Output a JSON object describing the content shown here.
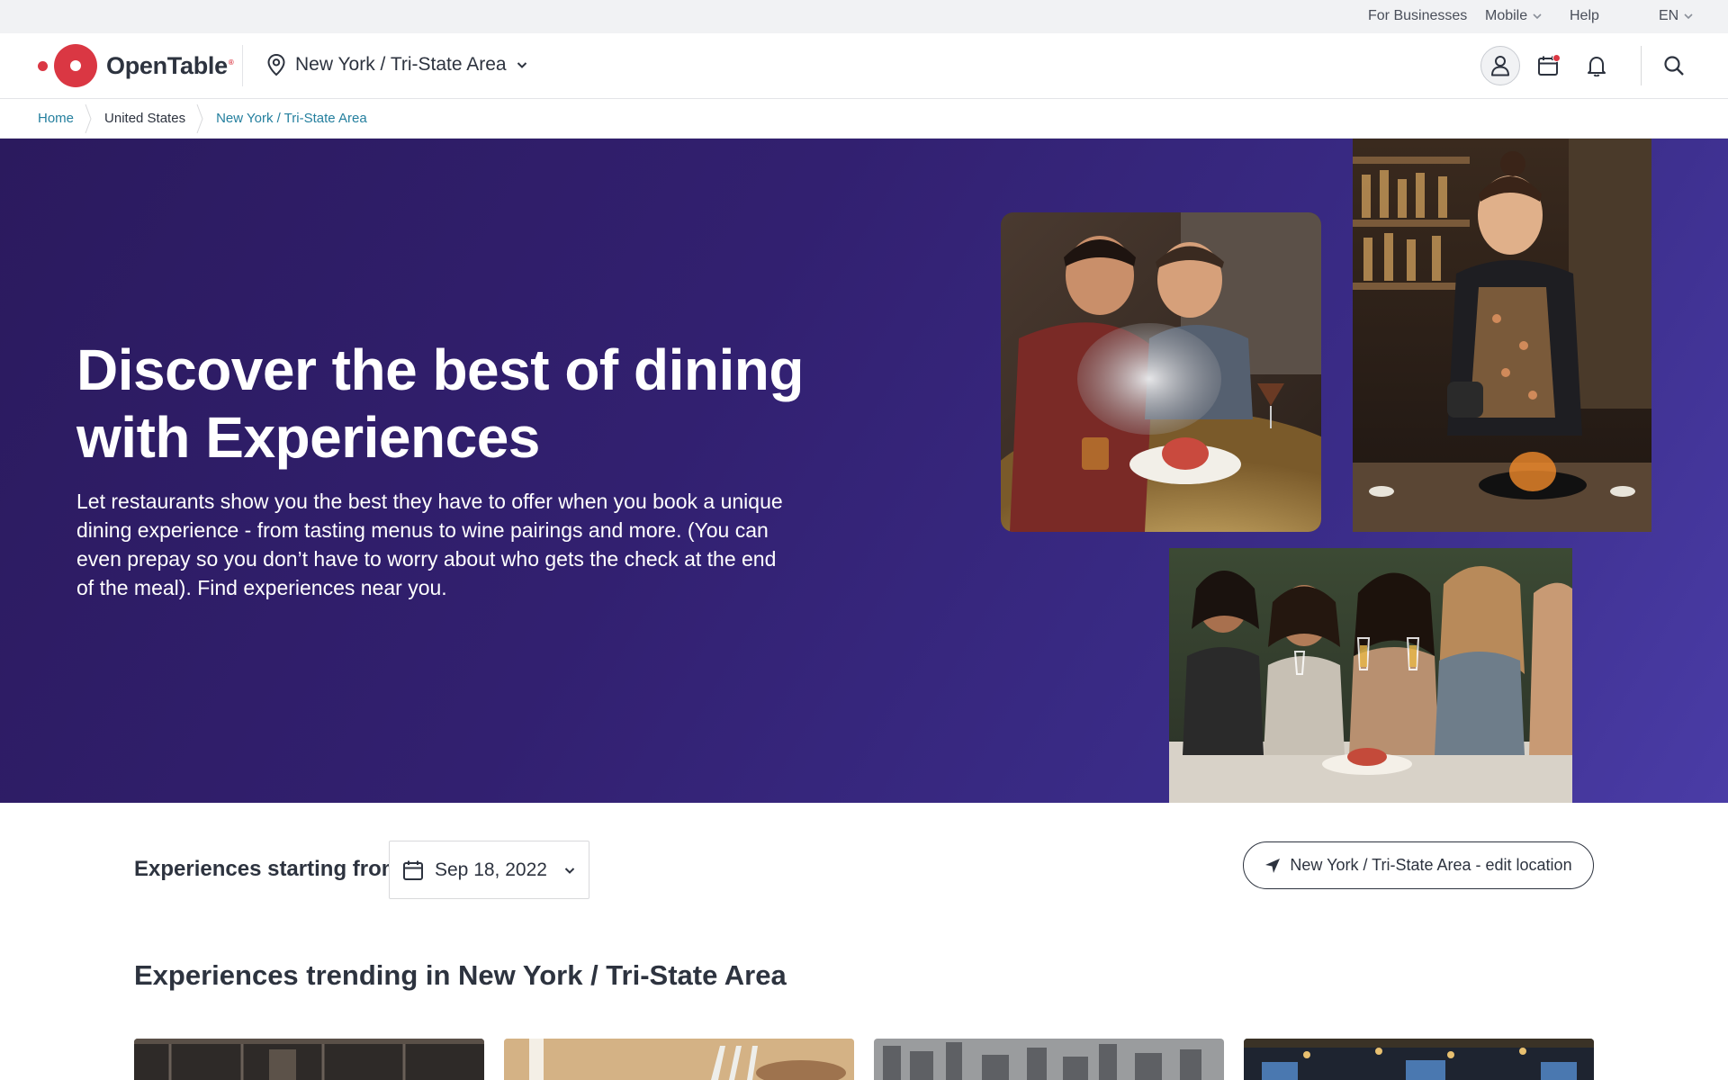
{
  "utility_bar": {
    "for_businesses": "For Businesses",
    "mobile": "Mobile",
    "help": "Help",
    "language": "EN"
  },
  "header": {
    "logo_text": "OpenTable",
    "location": "New York / Tri-State Area"
  },
  "breadcrumb": {
    "items": [
      "Home",
      "United States",
      "New York / Tri-State Area"
    ]
  },
  "hero": {
    "title": "Discover the best of dining with Experiences",
    "description": "Let restaurants show you the best they have to offer when you book a unique dining experience - from tasting menus to wine pairings and more. (You can even prepay so you don’t have to worry about who gets the check at the end of the meal). Find experiences near you."
  },
  "filters": {
    "label": "Experiences starting from",
    "date": "Sep 18, 2022",
    "location_button": "New York / Tri-State Area - edit location"
  },
  "trending": {
    "heading": "Experiences trending in New York / Tri-State Area"
  },
  "colors": {
    "brand": "#da3743",
    "hero_bg": "#2b1a5e",
    "link": "#247f9e"
  }
}
